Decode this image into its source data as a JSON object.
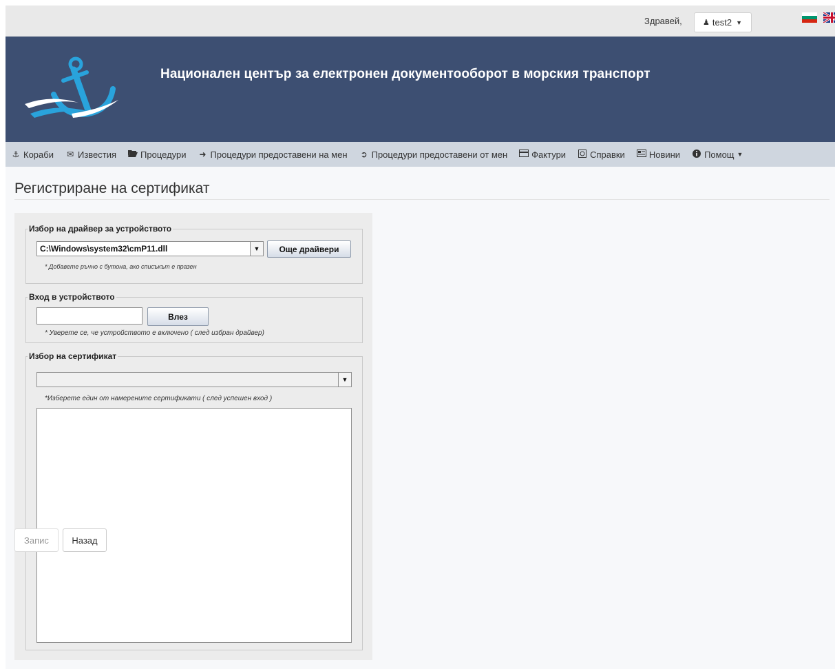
{
  "topbar": {
    "greeting": "Здравей,",
    "user": "test2",
    "user_icon": "user-icon",
    "languages": [
      "bg-flag-icon",
      "en-flag-icon"
    ]
  },
  "banner": {
    "title": "Национален център за електронен документооборот в морския транспорт",
    "logo_icon": "anchor-logo-icon"
  },
  "nav": {
    "items": [
      {
        "label": "Кораби",
        "icon": "anchor-icon"
      },
      {
        "label": "Известия",
        "icon": "envelope-icon"
      },
      {
        "label": "Процедури",
        "icon": "folder-open-icon"
      },
      {
        "label": "Процедури предоставени на мен",
        "icon": "sign-in-icon"
      },
      {
        "label": "Процедури предоставени от мен",
        "icon": "sign-out-icon"
      },
      {
        "label": "Фактури",
        "icon": "credit-card-icon"
      },
      {
        "label": "Справки",
        "icon": "report-icon"
      },
      {
        "label": "Новини",
        "icon": "newspaper-icon"
      },
      {
        "label": "Помощ",
        "icon": "info-icon"
      }
    ]
  },
  "page": {
    "title": "Регистриране на сертификат"
  },
  "driver": {
    "legend": "Избор на драйвер за устройството",
    "selected": "C:\\Windows\\system32\\cmP11.dll",
    "more_button": "Още драйвери",
    "hint": "* Добавете ръчно с бутона, ако списъкът е празен"
  },
  "login": {
    "legend": "Вход в устройството",
    "value": "",
    "button": "Влез",
    "hint": "* Уверете се, че устройството е включено ( след избран драйвер)"
  },
  "certificate": {
    "legend": "Избор на сертификат",
    "selected": "",
    "hint": "*Изберете един от намерените сертификати ( след успешен вход )"
  },
  "actions": {
    "save": "Запис",
    "back": "Назад"
  },
  "colors": {
    "banner": "#3d4f72",
    "nav": "#cfd6df",
    "logo": "#29a3dc"
  }
}
